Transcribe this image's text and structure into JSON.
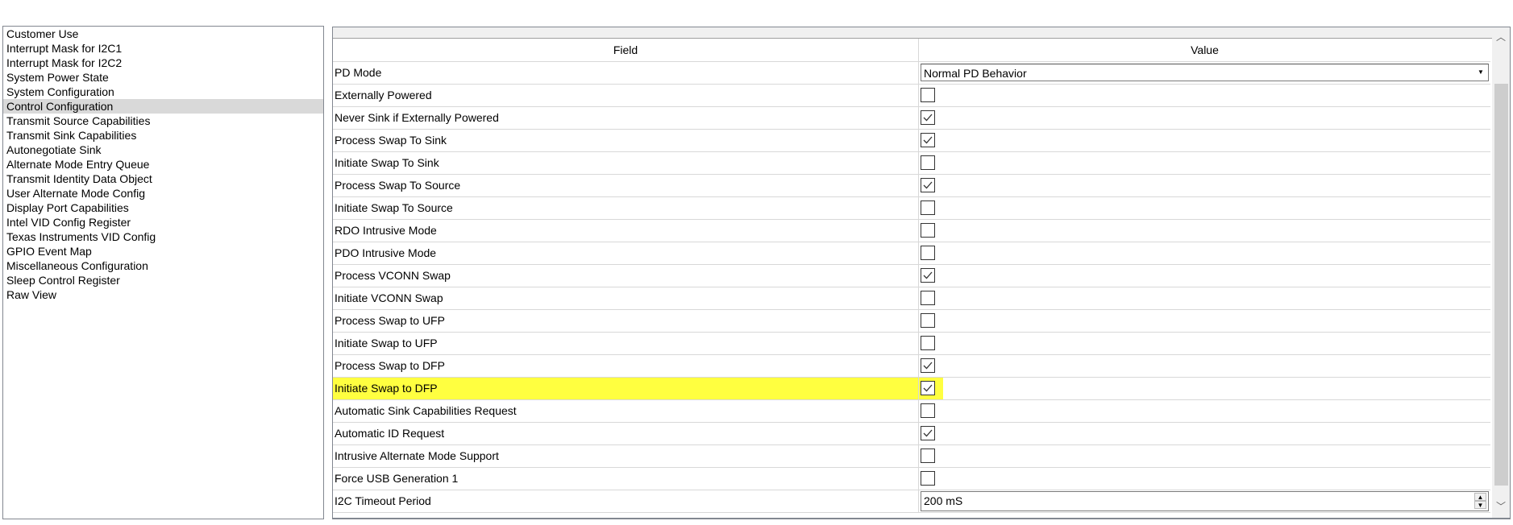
{
  "sidebar": {
    "items": [
      "Customer Use",
      "Interrupt Mask for I2C1",
      "Interrupt Mask for I2C2",
      "System Power State",
      "System Configuration",
      "Control Configuration",
      "Transmit Source Capabilities",
      "Transmit Sink Capabilities",
      "Autonegotiate Sink",
      "Alternate Mode Entry Queue",
      "Transmit Identity Data Object",
      "User Alternate Mode Config",
      "Display Port Capabilities",
      "Intel VID Config Register",
      "Texas Instruments VID Config",
      "GPIO Event Map",
      "Miscellaneous Configuration",
      "Sleep Control Register",
      "Raw View"
    ],
    "selected": "Control Configuration"
  },
  "grid": {
    "headers": {
      "field": "Field",
      "value": "Value"
    },
    "pd_mode": {
      "label": "PD Mode",
      "value": "Normal PD Behavior"
    },
    "checkbox_rows": [
      {
        "label": "Externally Powered",
        "checked": false
      },
      {
        "label": "Never Sink if Externally Powered",
        "checked": true
      },
      {
        "label": "Process Swap To Sink",
        "checked": true
      },
      {
        "label": "Initiate Swap To Sink",
        "checked": false
      },
      {
        "label": "Process Swap To Source",
        "checked": true
      },
      {
        "label": "Initiate Swap To Source",
        "checked": false
      },
      {
        "label": "RDO Intrusive Mode",
        "checked": false
      },
      {
        "label": "PDO Intrusive Mode",
        "checked": false
      },
      {
        "label": "Process VCONN Swap",
        "checked": true
      },
      {
        "label": "Initiate VCONN Swap",
        "checked": false
      },
      {
        "label": "Process Swap to UFP",
        "checked": false
      },
      {
        "label": "Initiate Swap to UFP",
        "checked": false
      },
      {
        "label": "Process Swap to DFP",
        "checked": true
      },
      {
        "label": "Initiate Swap to DFP",
        "checked": true,
        "highlighted": true
      },
      {
        "label": "Automatic Sink Capabilities Request",
        "checked": false
      },
      {
        "label": "Automatic ID Request",
        "checked": true
      },
      {
        "label": "Intrusive Alternate Mode Support",
        "checked": false
      },
      {
        "label": "Force USB Generation 1",
        "checked": false
      }
    ],
    "timeout": {
      "label": "I2C Timeout Period",
      "value": "200 mS"
    }
  },
  "colors": {
    "highlight": "#ffff40",
    "selection": "#d9d9d9"
  }
}
